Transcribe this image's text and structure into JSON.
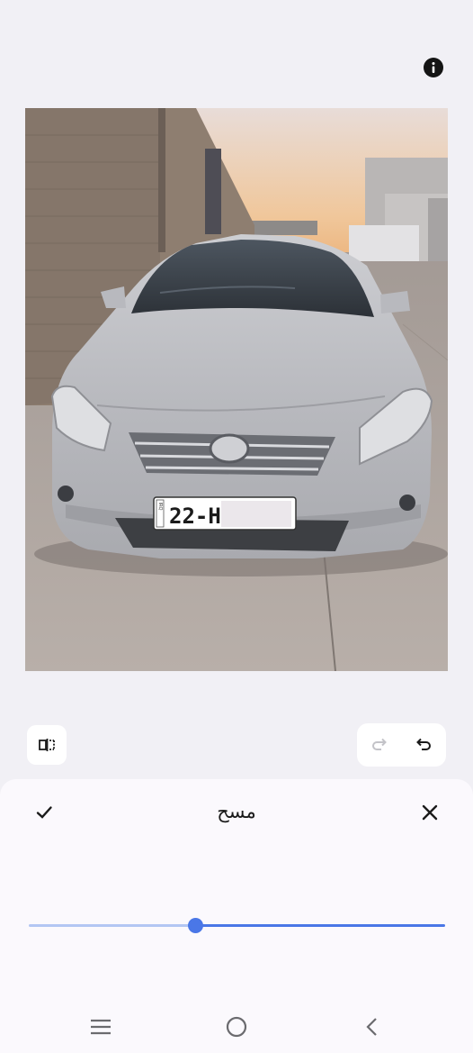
{
  "toolbar": {
    "info_icon": "info-icon"
  },
  "photo": {
    "license_plate_text": "22-H",
    "plate_side_text": "IRQ"
  },
  "controls": {
    "compare_icon": "compare-icon",
    "undo_icon": "undo-icon",
    "redo_icon": "redo-icon",
    "redo_enabled": false
  },
  "sheet": {
    "title": "مسح",
    "confirm_icon": "check-icon",
    "close_icon": "close-icon",
    "slider_value": 0.4
  },
  "nav": {
    "recents_icon": "menu-icon",
    "home_icon": "home-icon",
    "back_icon": "back-icon"
  },
  "colors": {
    "accent": "#4a77e7",
    "accent_light": "#b3c6f3",
    "background": "#f1f0f5",
    "sheet": "#fbf9fd"
  }
}
